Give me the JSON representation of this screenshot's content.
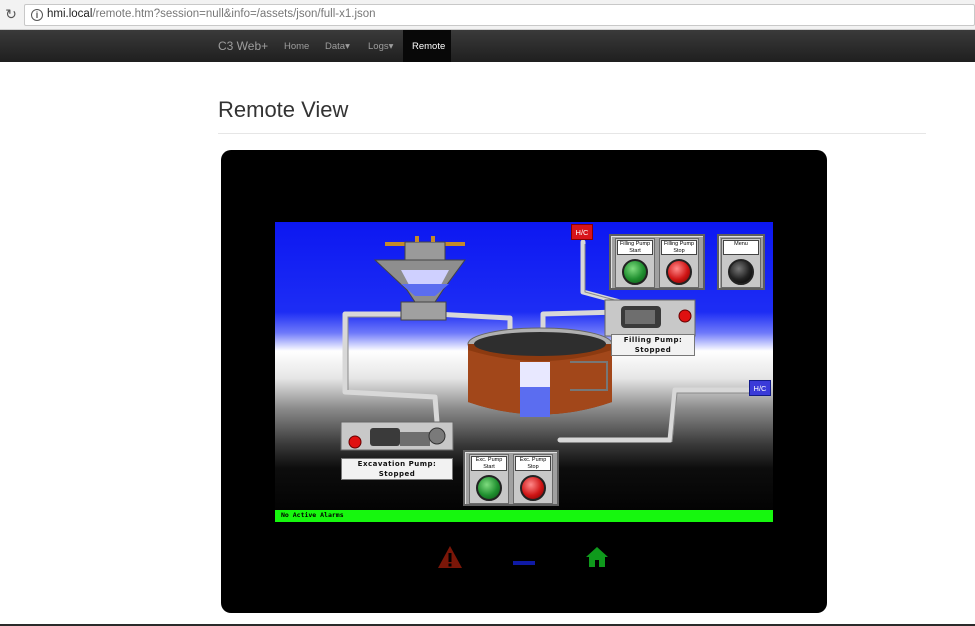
{
  "browser": {
    "url_host": "hmi.local",
    "url_path": "/remote.htm?session=null&info=/assets/json/full-x1.json",
    "reload_icon": "reload-icon",
    "info_icon": "info-icon"
  },
  "navbar": {
    "brand": "C3 Web+",
    "items": [
      {
        "label": "Home"
      },
      {
        "label": "Data"
      },
      {
        "label": "Logs"
      },
      {
        "label": "Remote",
        "active": true
      }
    ]
  },
  "page": {
    "title": "Remote View"
  },
  "hmi": {
    "filling_panel": {
      "start_label": "Filling Pump Start",
      "stop_label": "Filling Pump Stop"
    },
    "menu_label": "Menu",
    "hc_top": "H/C",
    "hc_right": "H/C",
    "filling_pump_status": [
      "Filling Pump:",
      "Stopped"
    ],
    "excavation_pump_status": [
      "Excavation Pump:",
      "Stopped"
    ],
    "exc_panel": {
      "start_label": "Exc. Pump Start",
      "stop_label": "Exc. Pump Stop"
    },
    "alarm_text": "No Active Alarms",
    "colors": {
      "start_button": "#1f8f2f",
      "stop_button": "#d01515",
      "alarm_bar": "#16f70e",
      "hc_top": "#d8141b",
      "hc_right": "#3a3ad8"
    }
  },
  "bottom_icons": [
    "warning-icon",
    "minus-icon",
    "home-icon"
  ]
}
